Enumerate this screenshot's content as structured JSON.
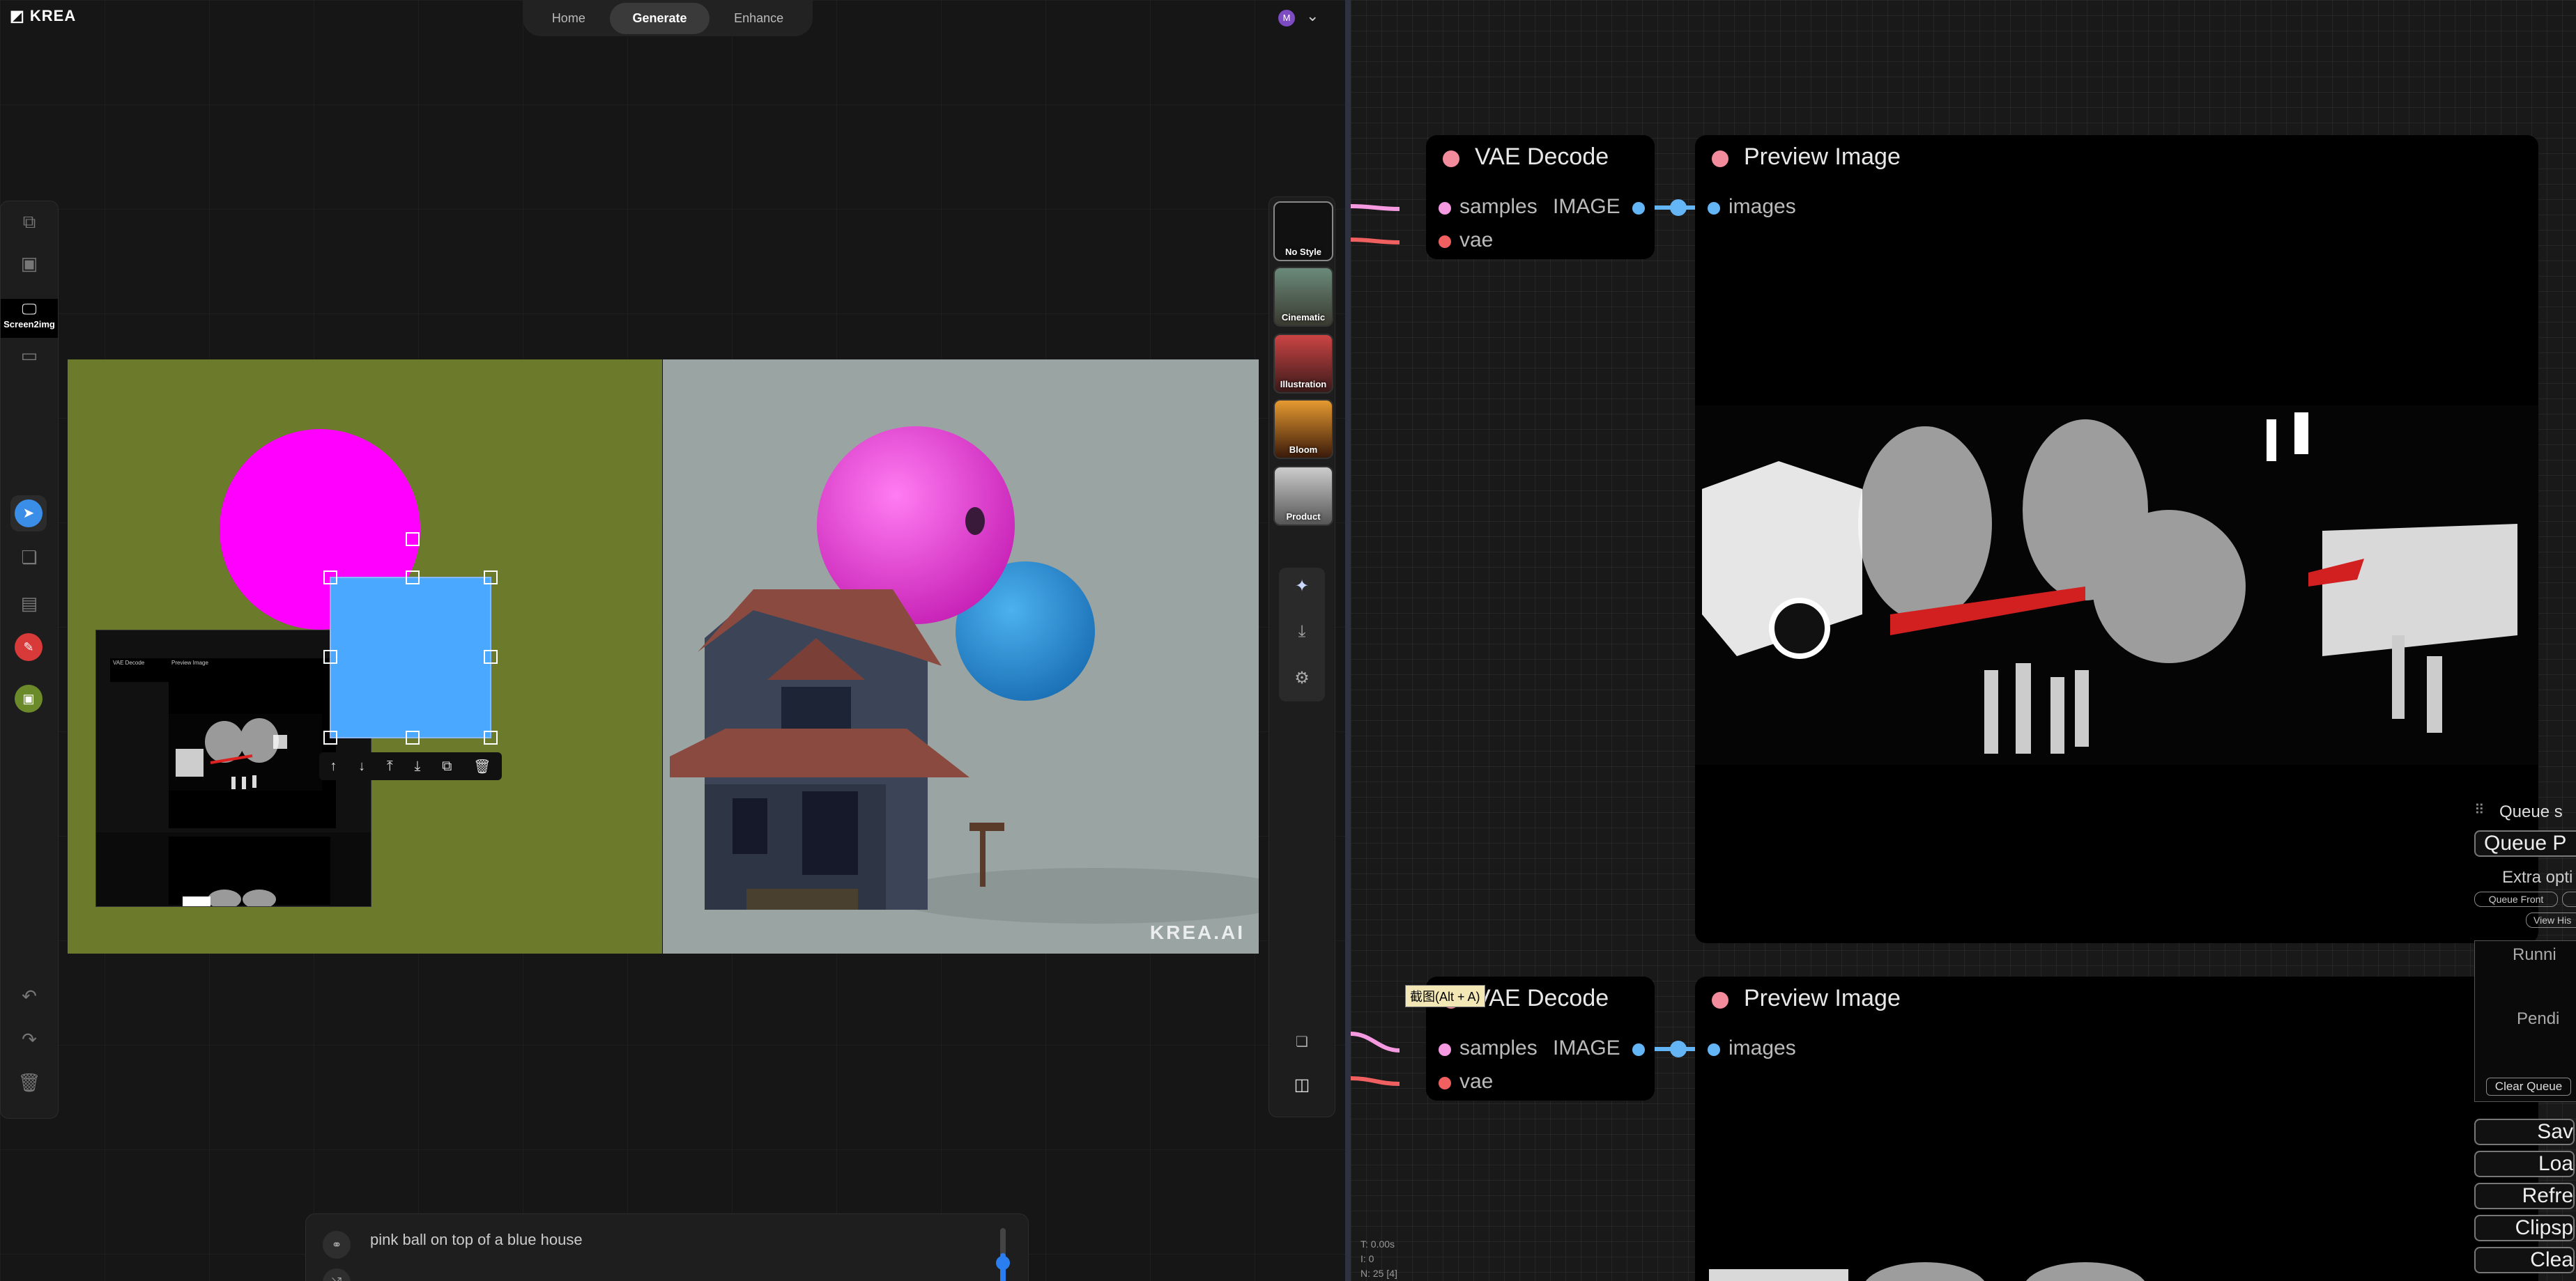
{
  "krea": {
    "logo": "KREA",
    "nav": {
      "tabs": [
        "Home",
        "Generate",
        "Enhance"
      ],
      "active": "Generate"
    },
    "avatar_initial": "M",
    "left_toolbar": {
      "screen_label": "Screen2img",
      "icons": [
        "video-icon",
        "image-icon",
        "screen-icon",
        "camera-icon",
        "cursor-icon",
        "layers-icon",
        "image-add-icon",
        "pen-icon",
        "image-icon",
        "undo-icon",
        "redo-icon",
        "trash-icon"
      ]
    },
    "canvas": {
      "left_bg": "#6b7a2b",
      "pink": "#ff00ff",
      "blue_square": "#4aa8ff",
      "watermark": "KREA.AI"
    },
    "embedded_screenshot": {
      "node_title_1": "VAE Decode",
      "node_title_2": "Preview Image"
    },
    "styles": [
      {
        "label": "No Style"
      },
      {
        "label": "Cinematic"
      },
      {
        "label": "Illustration"
      },
      {
        "label": "Bloom"
      },
      {
        "label": "Product"
      }
    ],
    "prompt": {
      "text": "pink ball on top of a blue house"
    }
  },
  "comfy": {
    "nodes": [
      {
        "title": "VAE Decode",
        "inputs": [
          "samples",
          "vae"
        ],
        "output": "IMAGE"
      },
      {
        "title": "Preview Image",
        "inputs": [
          "images"
        ]
      },
      {
        "title": "VAE Decode",
        "inputs": [
          "samples",
          "vae"
        ],
        "output": "IMAGE"
      },
      {
        "title": "Preview Image",
        "inputs": [
          "images"
        ]
      }
    ],
    "tooltip": "截图(Alt + A)",
    "queue_panel": {
      "title": "Queue s",
      "queue_prompt": "Queue P",
      "extra_options": "Extra opti",
      "queue_front": "Queue Front",
      "view_history": "View His",
      "running": "Runni",
      "pending": "Pendi",
      "clear_queue": "Clear Queue",
      "buttons": [
        "Sav",
        "Loa",
        "Refre",
        "Clipsp",
        "Clea"
      ]
    },
    "stats": [
      "T: 0.00s",
      "I: 0",
      "N: 25 [4]"
    ],
    "colors": {
      "samples": "#f59ae0",
      "vae": "#f06060",
      "image": "#64b5f6"
    }
  }
}
